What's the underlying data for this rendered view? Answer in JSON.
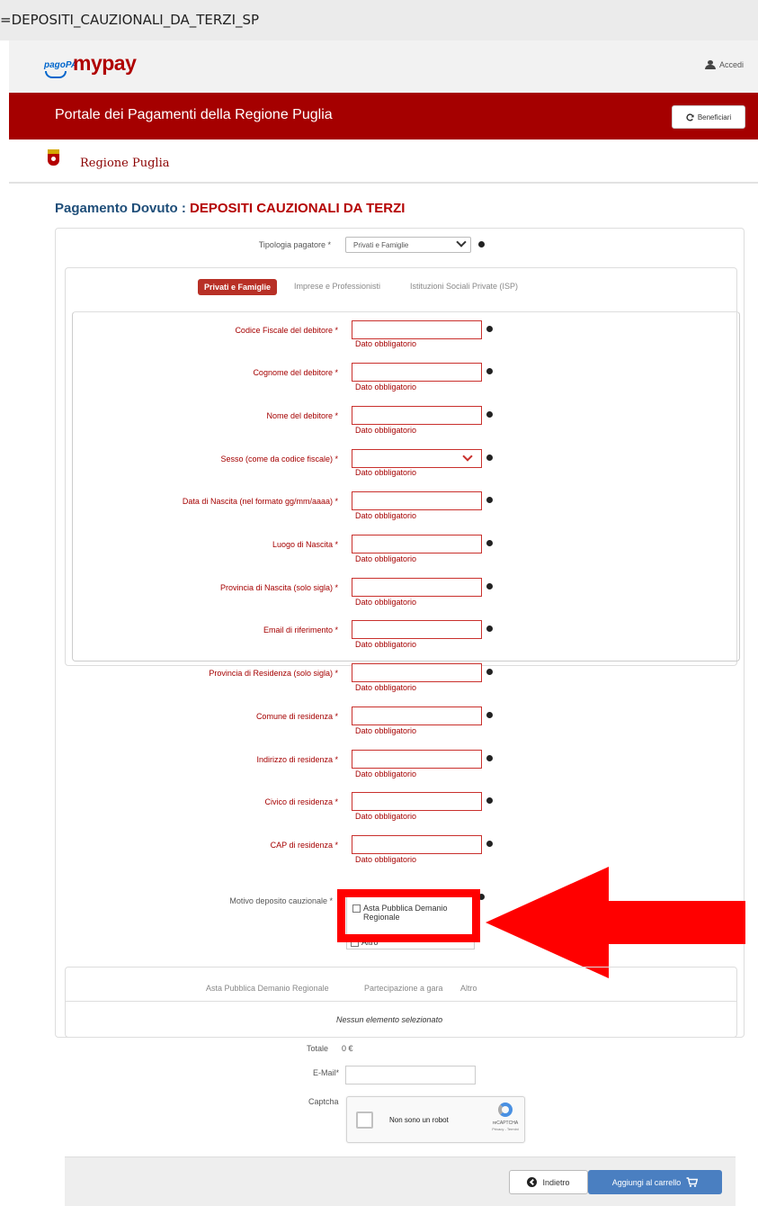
{
  "browser": {
    "url_fragment": "=DEPOSITI_CAUZIONALI_DA_TERZI_SP"
  },
  "header": {
    "logo_pagopa": "pagoPA",
    "logo_mypay": "mypay",
    "login_label": "Accedi",
    "portal_title": "Portale dei Pagamenti della Regione Puglia",
    "beneficiari_label": "Beneficiari",
    "region_name": "Regione Puglia"
  },
  "page": {
    "title_prefix": "Pagamento Dovuto :",
    "service_name": "DEPOSITI CAUZIONALI DA TERZI"
  },
  "form": {
    "tipologia_label": "Tipologia pagatore *",
    "tipologia_value": "Privati e Famiglie",
    "tabs": [
      "Privati e Famiglie",
      "Imprese e Professionisti",
      "Istituzioni Sociali Private (ISP)"
    ],
    "active_tab": "Privati e Famiglie",
    "required_msg": "Dato obbligatorio",
    "fields": [
      {
        "label": "Codice Fiscale del debitore *",
        "value": ""
      },
      {
        "label": "Cognome del debitore *",
        "value": ""
      },
      {
        "label": "Nome del debitore *",
        "value": ""
      },
      {
        "label": "Sesso (come da codice fiscale) *",
        "value": ""
      },
      {
        "label": "Data di Nascita (nel formato gg/mm/aaaa) *",
        "value": ""
      },
      {
        "label": "Luogo di Nascita *",
        "value": ""
      },
      {
        "label": "Provincia di Nascita (solo sigla) *",
        "value": ""
      },
      {
        "label": "Email di riferimento *",
        "value": ""
      },
      {
        "label": "Provincia di Residenza (solo sigla) *",
        "value": ""
      },
      {
        "label": "Comune di residenza *",
        "value": ""
      },
      {
        "label": "Indirizzo di residenza *",
        "value": ""
      },
      {
        "label": "Civico di residenza *",
        "value": ""
      },
      {
        "label": "CAP di residenza *",
        "value": ""
      }
    ],
    "motivo_label": "Motivo deposito cauzionale *",
    "motivo_options": [
      {
        "label_line1": "Asta Pubblica Demanio",
        "label_line2": "Regionale",
        "checked": false
      },
      {
        "label_line1": "Altro",
        "checked": false
      }
    ]
  },
  "selection": {
    "tabs": [
      "Asta Pubblica Demanio Regionale",
      "Partecipazione a gara",
      "Altro"
    ],
    "empty_message": "Nessun elemento selezionato"
  },
  "summary": {
    "totale_label": "Totale",
    "totale_value": "0 €",
    "email_label": "E-Mail*",
    "email_value": "",
    "captcha_label": "Captcha",
    "captcha_text": "Non sono un robot",
    "captcha_brand": "reCAPTCHA",
    "captcha_terms": "Privacy - Termini"
  },
  "buttons": {
    "back_label": "Indietro",
    "cart_label": "Aggiungi al carrello"
  },
  "colors": {
    "brand_red": "#a50000",
    "title_blue": "#1f4e79",
    "highlight_red": "#ff0000",
    "primary_button": "#4a7fc1"
  },
  "annotation": {
    "icon": "red-arrow-icon"
  }
}
